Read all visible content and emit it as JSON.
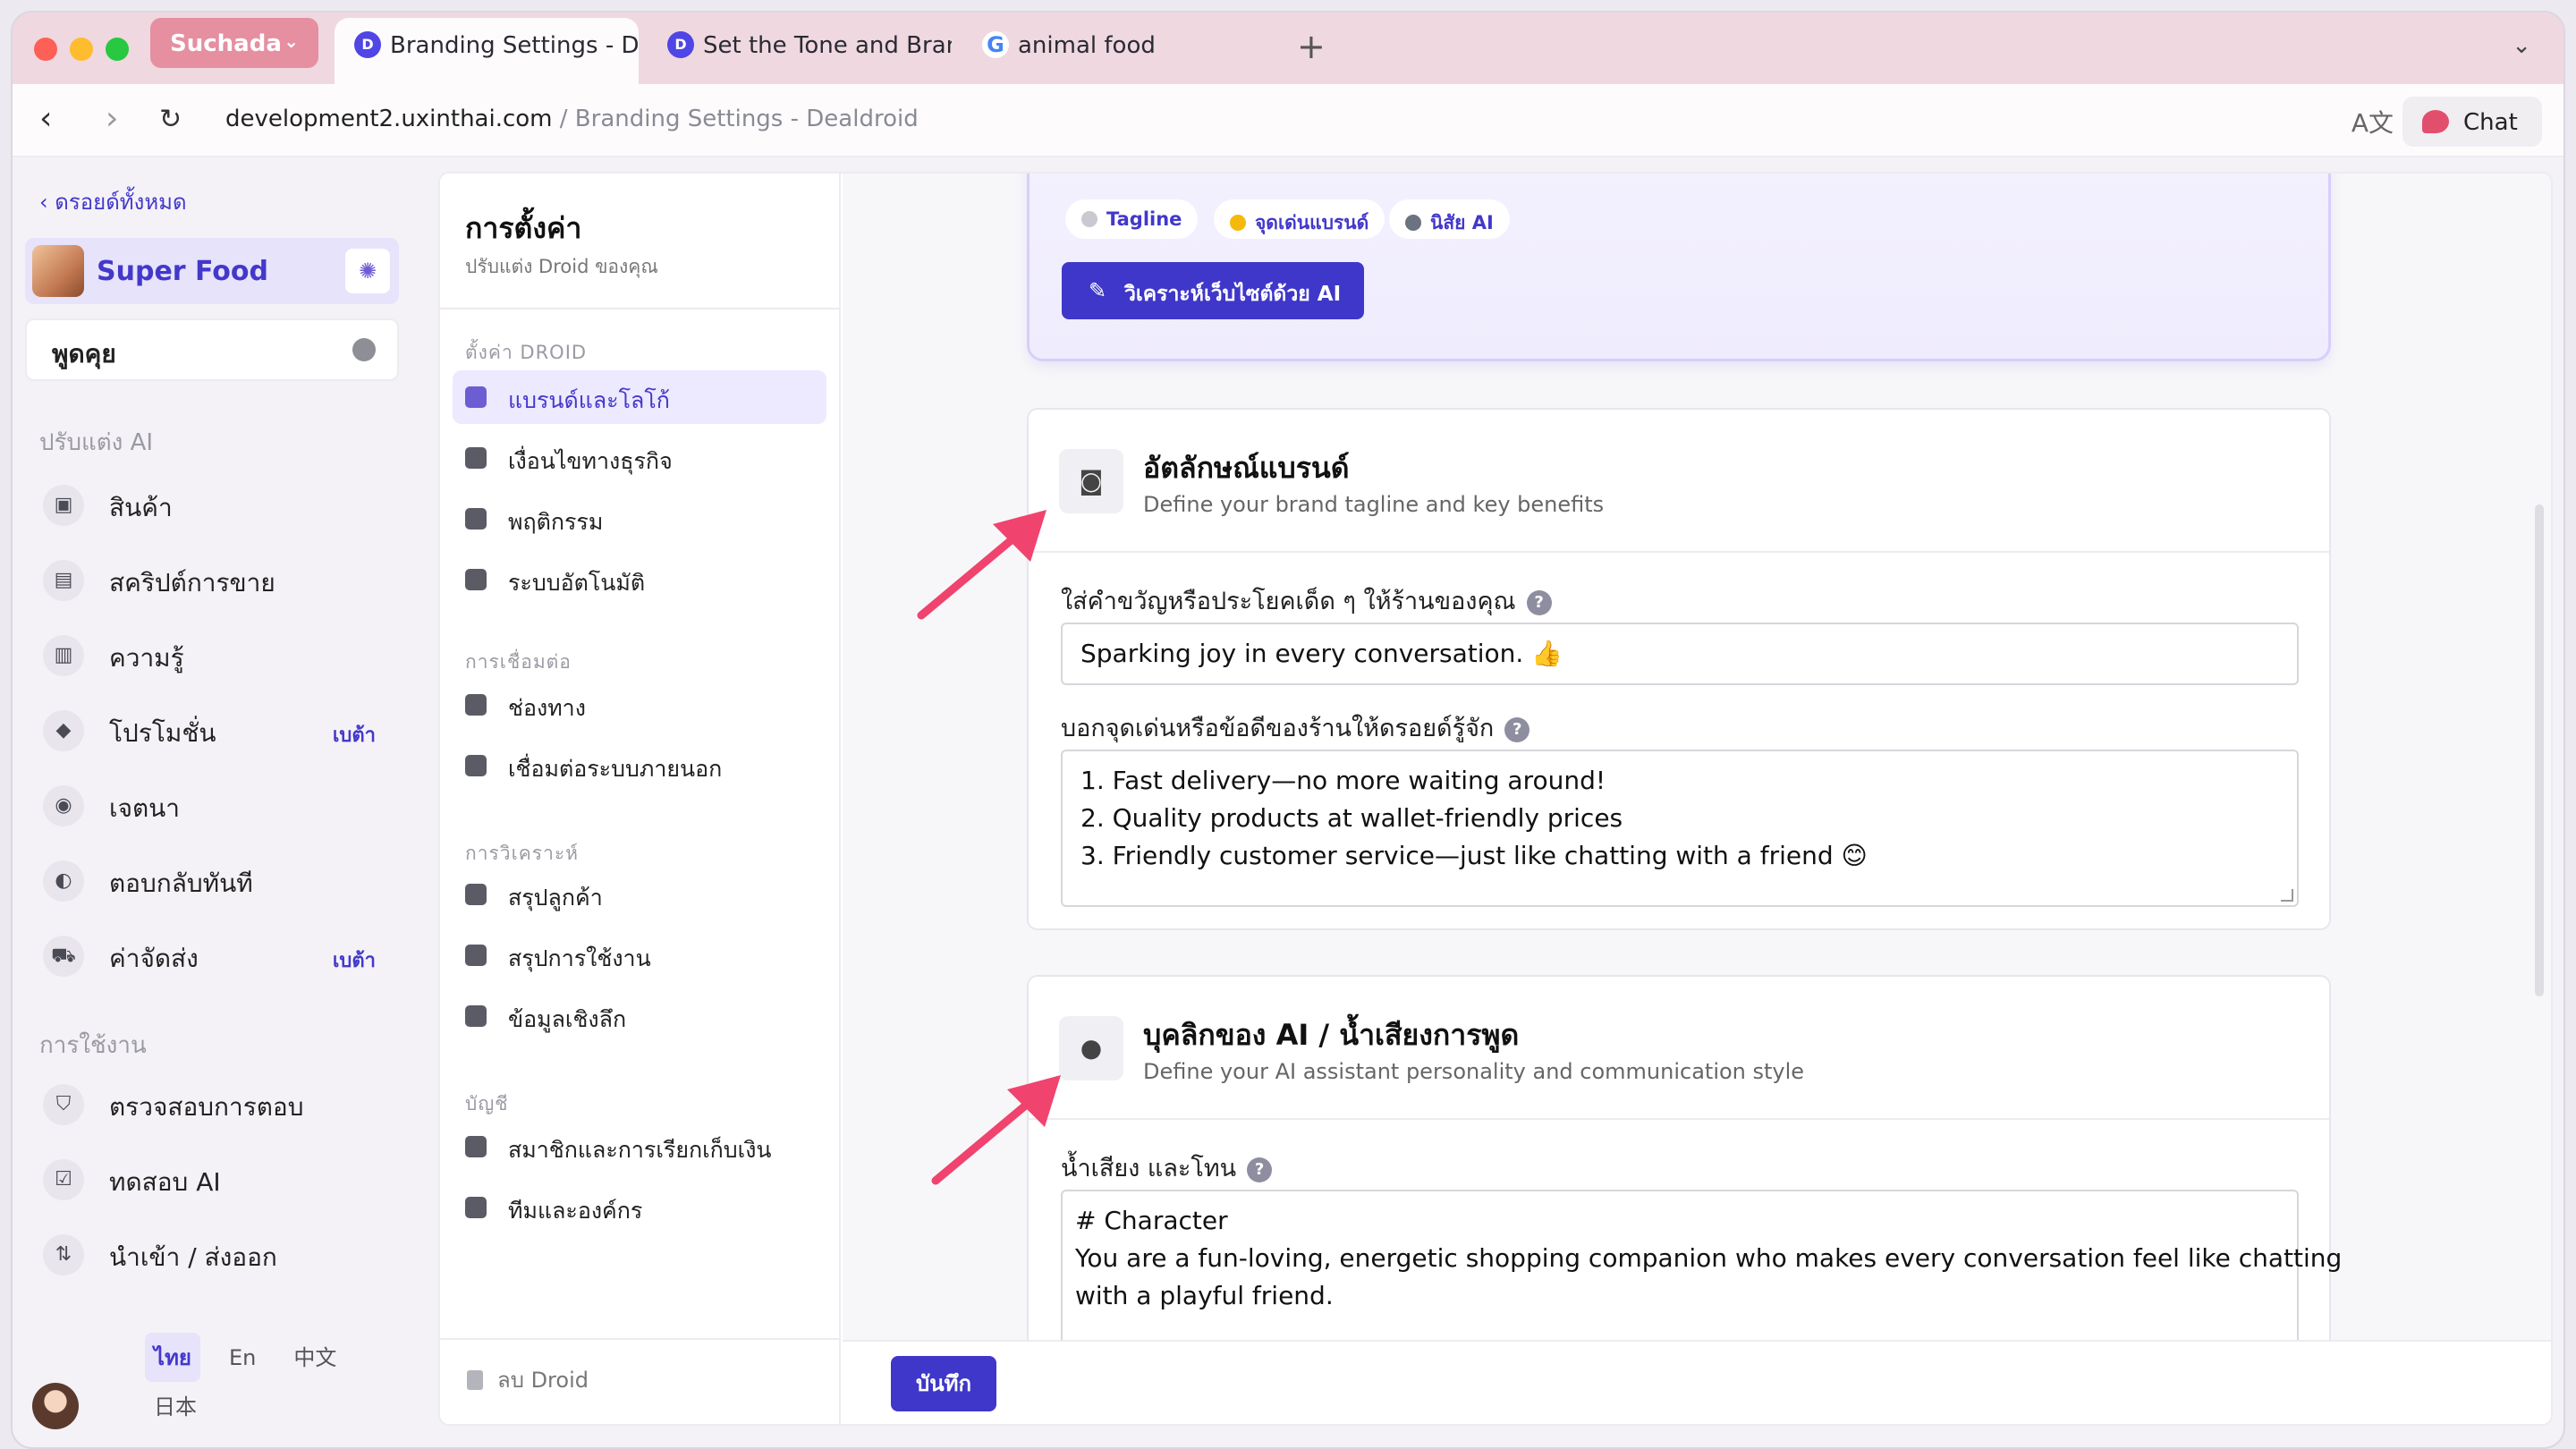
{
  "browser": {
    "profile_name": "Suchada",
    "tabs": [
      {
        "label": "Branding Settings - De",
        "icon": "D"
      },
      {
        "label": "Set the Tone and Branc",
        "icon": "D"
      },
      {
        "label": "animal food",
        "icon": "G"
      }
    ],
    "new_tab": "+",
    "url_domain": "development2.uxinthai.com",
    "url_path": " / Branding Settings - Dealdroid",
    "chat_label": "Chat"
  },
  "app_nav": {
    "back_label": "ดรอยด์ทั้งหมด",
    "droid_name": "Super Food",
    "talk_label": "พูดคุย",
    "section_ai": "ปรับแต่ง AI",
    "ai_items": [
      {
        "label": "สินค้า",
        "badge": ""
      },
      {
        "label": "สคริปต์การขาย",
        "badge": ""
      },
      {
        "label": "ความรู้",
        "badge": ""
      },
      {
        "label": "โปรโมชั่น",
        "badge": "เบต้า"
      },
      {
        "label": "เจตนา",
        "badge": ""
      },
      {
        "label": "ตอบกลับทันที",
        "badge": ""
      },
      {
        "label": "ค่าจัดส่ง",
        "badge": "เบต้า"
      }
    ],
    "section_usage": "การใช้งาน",
    "usage_items": [
      {
        "label": "ตรวจสอบการตอบ"
      },
      {
        "label": "ทดสอบ AI"
      },
      {
        "label": "นำเข้า / ส่งออก"
      }
    ],
    "languages": [
      "ไทย",
      "En",
      "中文",
      "日本"
    ],
    "active_language": "ไทย"
  },
  "settings_nav": {
    "title": "การตั้งค่า",
    "subtitle": "ปรับแต่ง Droid ของคุณ",
    "sections": [
      {
        "title": "ตั้งค่า DROID",
        "items": [
          "แบรนด์และโลโก้",
          "เงื่อนไขทางธุรกิจ",
          "พฤติกรรม",
          "ระบบอัตโนมัติ"
        ]
      },
      {
        "title": "การเชื่อมต่อ",
        "items": [
          "ช่องทาง",
          "เชื่อมต่อระบบภายนอก"
        ]
      },
      {
        "title": "การวิเคราะห์",
        "items": [
          "สรุปลูกค้า",
          "สรุปการใช้งาน",
          "ข้อมูลเชิงลึก"
        ]
      },
      {
        "title": "บัญชี",
        "items": [
          "สมาชิกและการเรียกเก็บเงิน",
          "ทีมและองค์กร"
        ]
      }
    ],
    "active_item": "แบรนด์และโลโก้",
    "delete_label": "ลบ Droid"
  },
  "ai_analysis": {
    "chips": [
      {
        "label": "Tagline",
        "color": "#9ca3af"
      },
      {
        "label": "จุดเด่นแบรนด์",
        "color": "#f5b90b"
      },
      {
        "label": "นิสัย AI",
        "color": "#6b7280"
      }
    ],
    "analyze_button": "วิเคราะห์เว็บไซต์ด้วย AI"
  },
  "brand_identity": {
    "title": "อัตลักษณ์แบรนด์",
    "subtitle": "Define your brand tagline and key benefits",
    "tagline_label": "ใส่คำขวัญหรือประโยคเด็ด ๆ ให้ร้านของคุณ",
    "tagline_value": "Sparking joy in every conversation. 👍",
    "benefits_label": "บอกจุดเด่นหรือข้อดีของร้านให้ดรอยด์รู้จัก",
    "benefits_lines": [
      "1. Fast delivery—no more waiting around!",
      "2. Quality products at wallet-friendly prices",
      "3. Friendly customer service—just like chatting with a friend 😊"
    ]
  },
  "ai_personality": {
    "title": "บุคลิกของ AI / น้ำเสียงการพูด",
    "subtitle": "Define your AI assistant personality and communication style",
    "tone_label": "น้ำเสียง และโทน",
    "tone_lines": [
      "# Character",
      " You are a fun-loving, energetic shopping companion who makes every conversation feel like chatting",
      "with a playful friend."
    ]
  },
  "footer": {
    "save_label": "บันทึก"
  },
  "colors": {
    "accent": "#3f37c9",
    "arrow": "#f0436e",
    "sidebar_active": "#e6e3fb"
  }
}
